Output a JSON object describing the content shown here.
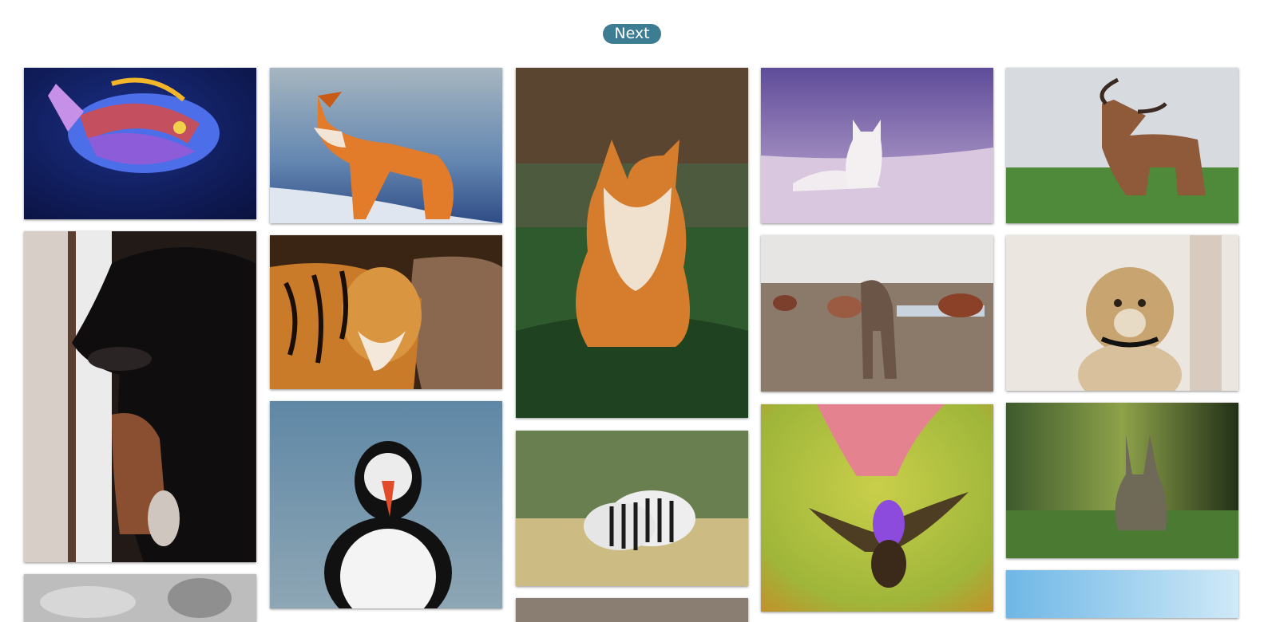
{
  "pagination": {
    "next_label": "Next"
  },
  "gallery": {
    "photos": [
      {
        "subject": "tropical-fish"
      },
      {
        "subject": "red-fox-in-snow"
      },
      {
        "subject": "red-fox-sitting"
      },
      {
        "subject": "arctic-fox"
      },
      {
        "subject": "highland-cow"
      },
      {
        "subject": "dogs-at-window"
      },
      {
        "subject": "tiger"
      },
      {
        "subject": "horses-on-field"
      },
      {
        "subject": "cheetah-cub"
      },
      {
        "subject": "puffin"
      },
      {
        "subject": "zebras"
      },
      {
        "subject": "hummingbird"
      },
      {
        "subject": "rabbit"
      },
      {
        "subject": "grayscale-animal"
      },
      {
        "subject": "partial-photo"
      },
      {
        "subject": "sky-photo"
      }
    ]
  },
  "colors": {
    "button": "#3d7d93",
    "background": "#ffffff"
  }
}
